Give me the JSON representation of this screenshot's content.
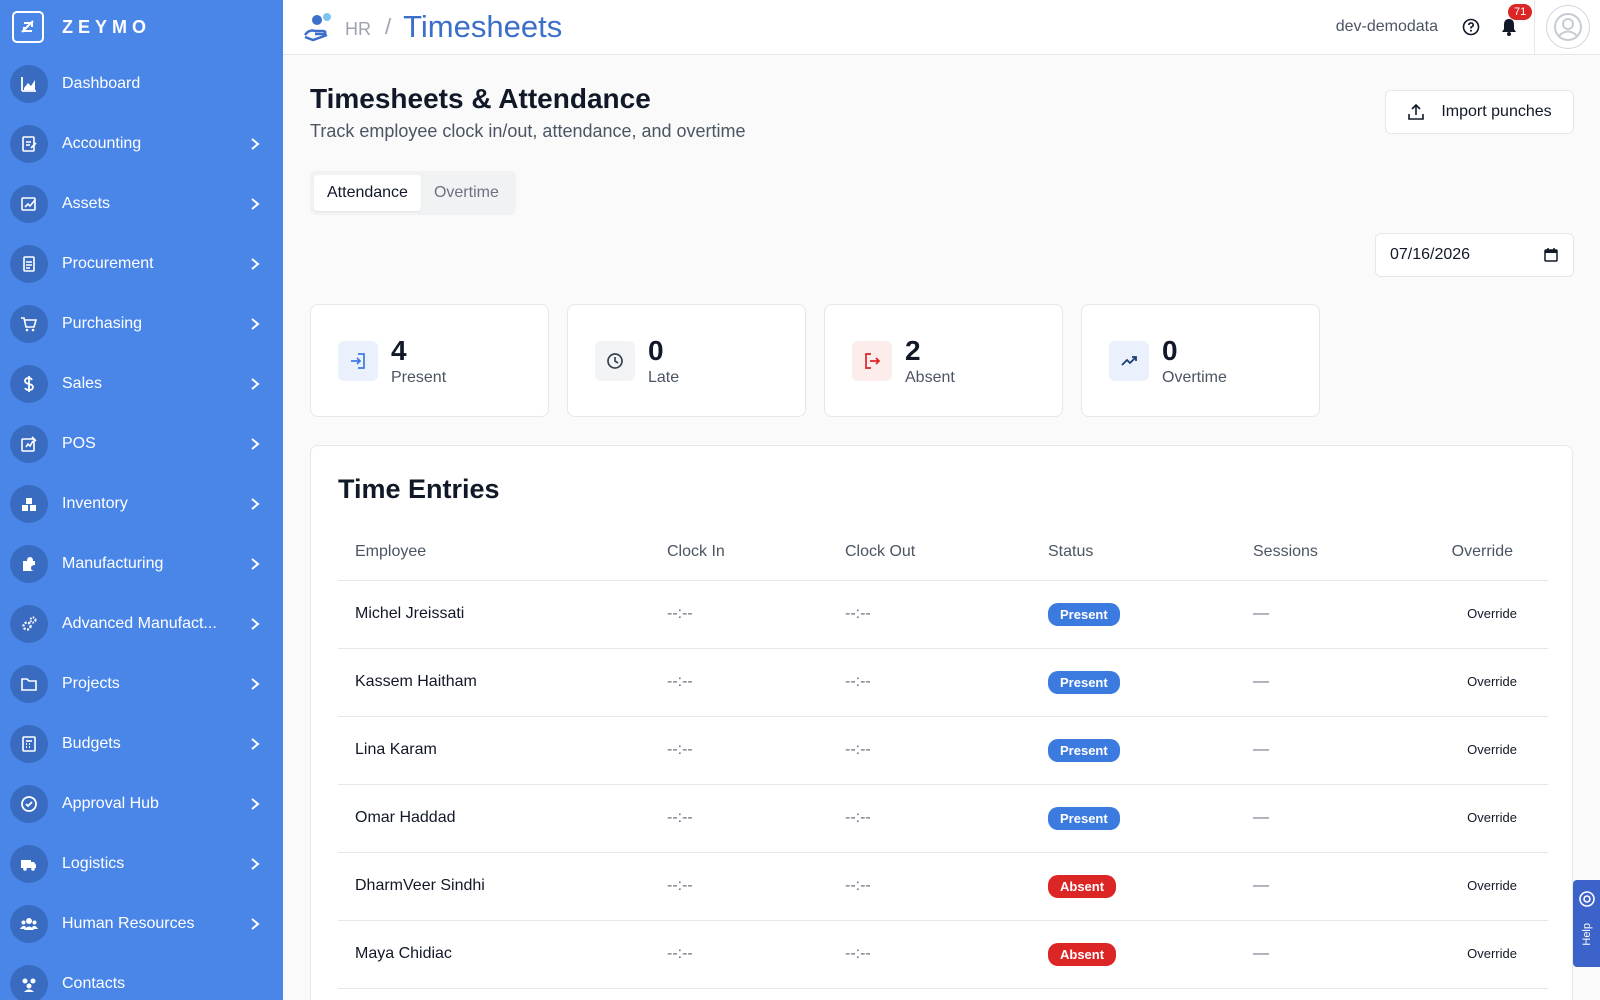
{
  "brand": {
    "name": "ZEYMO"
  },
  "sidebar": {
    "items": [
      {
        "label": "Dashboard",
        "icon": "chart-icon",
        "has_chevron": false
      },
      {
        "label": "Accounting",
        "icon": "ledger-icon",
        "has_chevron": true
      },
      {
        "label": "Assets",
        "icon": "asset-icon",
        "has_chevron": true
      },
      {
        "label": "Procurement",
        "icon": "document-icon",
        "has_chevron": true
      },
      {
        "label": "Purchasing",
        "icon": "cart-icon",
        "has_chevron": true
      },
      {
        "label": "Sales",
        "icon": "dollar-icon",
        "has_chevron": true
      },
      {
        "label": "POS",
        "icon": "pos-icon",
        "has_chevron": true
      },
      {
        "label": "Inventory",
        "icon": "boxes-icon",
        "has_chevron": true
      },
      {
        "label": "Manufacturing",
        "icon": "puzzle-icon",
        "has_chevron": true
      },
      {
        "label": "Advanced Manufact...",
        "icon": "gears-icon",
        "has_chevron": true
      },
      {
        "label": "Projects",
        "icon": "folder-icon",
        "has_chevron": true
      },
      {
        "label": "Budgets",
        "icon": "calculator-icon",
        "has_chevron": true
      },
      {
        "label": "Approval Hub",
        "icon": "check-circle-icon",
        "has_chevron": true
      },
      {
        "label": "Logistics",
        "icon": "truck-icon",
        "has_chevron": true
      },
      {
        "label": "Human Resources",
        "icon": "people-icon",
        "has_chevron": true
      },
      {
        "label": "Contacts",
        "icon": "contacts-icon",
        "has_chevron": false
      }
    ]
  },
  "topbar": {
    "breadcrumb_parent": "HR",
    "breadcrumb_sep": "/",
    "title": "Timesheets",
    "org": "dev-demodata",
    "notification_count": "71"
  },
  "page": {
    "title": "Timesheets & Attendance",
    "subtitle": "Track employee clock in/out, attendance, and overtime",
    "import_label": "Import punches",
    "tabs": [
      {
        "label": "Attendance",
        "active": true
      },
      {
        "label": "Overtime",
        "active": false
      }
    ],
    "date_value": "07/16/2026"
  },
  "stats": [
    {
      "value": "4",
      "label": "Present",
      "icon": "login-icon",
      "bg": "#eaf1fd",
      "color": "#3b7be0"
    },
    {
      "value": "0",
      "label": "Late",
      "icon": "clock-icon",
      "bg": "#f3f4f6",
      "color": "#374151"
    },
    {
      "value": "2",
      "label": "Absent",
      "icon": "logout-icon",
      "bg": "#fdecec",
      "color": "#dc2626"
    },
    {
      "value": "0",
      "label": "Overtime",
      "icon": "trend-up-icon",
      "bg": "#eaf1fd",
      "color": "#1f3f7a"
    }
  ],
  "entries": {
    "title": "Time Entries",
    "columns": [
      "Employee",
      "Clock In",
      "Clock Out",
      "Status",
      "Sessions",
      "Override"
    ],
    "rows": [
      {
        "employee": "Michel Jreissati",
        "clock_in": "--:--",
        "clock_out": "--:--",
        "status": "Present",
        "sessions": "—",
        "override": "Override"
      },
      {
        "employee": "Kassem Haitham",
        "clock_in": "--:--",
        "clock_out": "--:--",
        "status": "Present",
        "sessions": "—",
        "override": "Override"
      },
      {
        "employee": "Lina Karam",
        "clock_in": "--:--",
        "clock_out": "--:--",
        "status": "Present",
        "sessions": "—",
        "override": "Override"
      },
      {
        "employee": "Omar Haddad",
        "clock_in": "--:--",
        "clock_out": "--:--",
        "status": "Present",
        "sessions": "—",
        "override": "Override"
      },
      {
        "employee": "DharmVeer Sindhi",
        "clock_in": "--:--",
        "clock_out": "--:--",
        "status": "Absent",
        "sessions": "—",
        "override": "Override"
      },
      {
        "employee": "Maya Chidiac",
        "clock_in": "--:--",
        "clock_out": "--:--",
        "status": "Absent",
        "sessions": "—",
        "override": "Override"
      }
    ]
  },
  "help_tab": {
    "label": "Help"
  },
  "colors": {
    "sidebar": "#4a86e8",
    "accent": "#3b6fc9",
    "present": "#3b7be0",
    "absent": "#dc2626"
  }
}
